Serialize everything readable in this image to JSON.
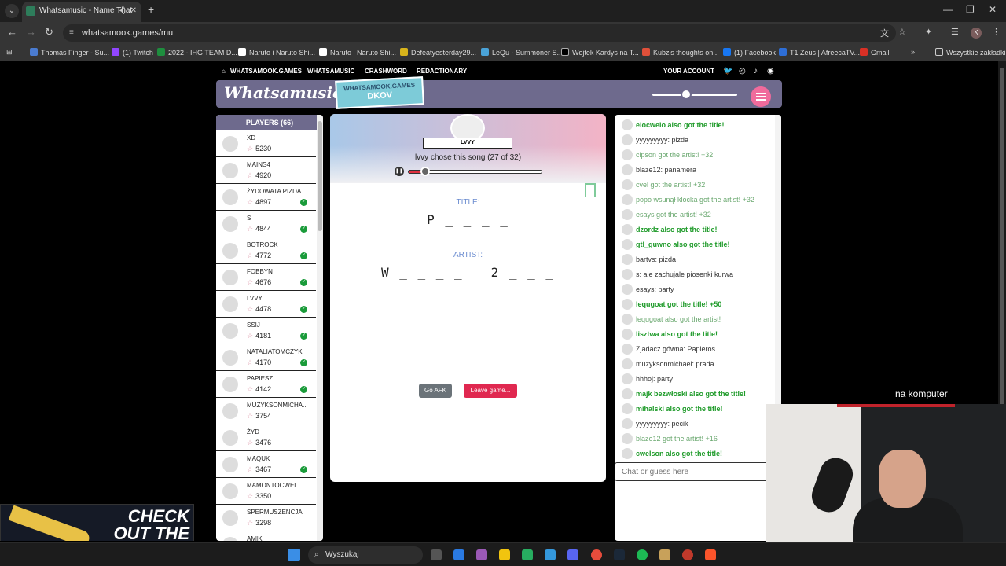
{
  "browser": {
    "tab_title": "Whatsamusic - Name That",
    "url": "whatsamook.games/mu",
    "bookmarks": [
      "Thomas Finger - Su...",
      "(1) Twitch",
      "2022 - IHG TEAM D...",
      "Naruto i Naruto Shi...",
      "Naruto i Naruto Shi...",
      "Defeatyesterday29...",
      "LeQu - Summoner S...",
      "Wojtek Kardys na T...",
      "Kubz's thoughts on...",
      "(1) Facebook",
      "T1 Zeus | AfreecaTV...",
      "Gmail",
      "Wszystkie zakładki"
    ],
    "avatar_letter": "K"
  },
  "sitenav": {
    "items": [
      "WHATSAMOOK.GAMES",
      "WHATSAMUSIC",
      "CRASHWORD",
      "REDACTIONARY"
    ],
    "account": "YOUR ACCOUNT"
  },
  "header": {
    "logo": "Whatsamusic",
    "badge_top": "WHATSAMOOK.GAMES",
    "badge_bottom": "DKOV",
    "volume_level": 0.33
  },
  "players": {
    "title": "PLAYERS (66)",
    "list": [
      {
        "name": "XD",
        "score": "5230",
        "guessed": false
      },
      {
        "name": "MAINS4",
        "score": "4920",
        "guessed": false
      },
      {
        "name": "ŻYDOWATA PIZDA",
        "score": "4897",
        "guessed": true
      },
      {
        "name": "S",
        "score": "4844",
        "guessed": true
      },
      {
        "name": "BOTROCK",
        "score": "4772",
        "guessed": true
      },
      {
        "name": "FOBBYN",
        "score": "4676",
        "guessed": true
      },
      {
        "name": "LVVY",
        "score": "4478",
        "guessed": true
      },
      {
        "name": "SSIJ",
        "score": "4181",
        "guessed": true
      },
      {
        "name": "NATALIATOMCZYK",
        "score": "4170",
        "guessed": true
      },
      {
        "name": "PAPIESZ",
        "score": "4142",
        "guessed": true
      },
      {
        "name": "MUZYKSONMICHA...",
        "score": "3754",
        "guessed": false
      },
      {
        "name": "ŻYD",
        "score": "3476",
        "guessed": false
      },
      {
        "name": "MAQUK",
        "score": "3467",
        "guessed": true
      },
      {
        "name": "MAMONTOCWEL",
        "score": "3350",
        "guessed": false
      },
      {
        "name": "SPERMUSZENCJA",
        "score": "3298",
        "guessed": false
      },
      {
        "name": "AMIK",
        "score": "",
        "guessed": false
      }
    ]
  },
  "game": {
    "chooser": "LVVY",
    "song_info": "lvvy chose this song (27 of 32)",
    "progress": 0.09,
    "title_label": "TITLE:",
    "title_hint": "P _ _ _ _",
    "artist_label": "ARTIST:",
    "artist_hint": "W _ _ _ _   2 _ _ _",
    "afk_label": "Go AFK",
    "leave_label": "Leave game..."
  },
  "chat": {
    "messages": [
      {
        "text": "elocwelo also got the title!",
        "style": "g"
      },
      {
        "text": "yyyyyyyyy: pizda",
        "style": "n"
      },
      {
        "text": "cipson got the artist! +32",
        "style": "s"
      },
      {
        "text": "blaze12: panamera",
        "style": "n"
      },
      {
        "text": "cvel got the artist! +32",
        "style": "s"
      },
      {
        "text": "popo wsunął klocka got the artist! +32",
        "style": "s"
      },
      {
        "text": "esays got the artist! +32",
        "style": "s"
      },
      {
        "text": "dzordz also got the title!",
        "style": "g"
      },
      {
        "text": "gtl_guwno also got the title!",
        "style": "g"
      },
      {
        "text": "bartvs: pizda",
        "style": "n"
      },
      {
        "text": "s: ale zachujale piosenki kurwa",
        "style": "n"
      },
      {
        "text": "esays: party",
        "style": "n"
      },
      {
        "text": "lequgoat got the title! +50",
        "style": "g"
      },
      {
        "text": "lequgoat also got the artist!",
        "style": "s"
      },
      {
        "text": "lisztwa also got the title!",
        "style": "g"
      },
      {
        "text": "Zjadacz gówna: Papieros",
        "style": "n"
      },
      {
        "text": "muzyksonmichael: prada",
        "style": "n"
      },
      {
        "text": "hhhoj: party",
        "style": "n"
      },
      {
        "text": "majk bezwłoski also got the title!",
        "style": "g"
      },
      {
        "text": "mihalski also got the title!",
        "style": "g"
      },
      {
        "text": "yyyyyyyyy: pecik",
        "style": "n"
      },
      {
        "text": "blaze12 got the artist! +16",
        "style": "s"
      },
      {
        "text": "cwelson also got the title!",
        "style": "g"
      }
    ],
    "placeholder": "Chat or guess here"
  },
  "overlay": {
    "cam_title": "na komputer",
    "promo": "CHECK OUT THE BEST CASES"
  },
  "taskbar": {
    "search": "Wyszukaj"
  },
  "colors": {
    "header": "#6e6a8d",
    "badge": "#7dcbd8",
    "correct_green": "#1f9b2a",
    "leave_red": "#e02850"
  }
}
